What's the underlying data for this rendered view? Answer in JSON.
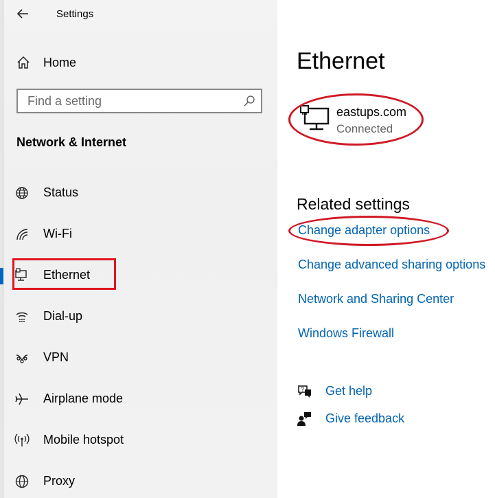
{
  "window": {
    "title": "Settings"
  },
  "sidebar": {
    "home_label": "Home",
    "search_placeholder": "Find a setting",
    "section_title": "Network & Internet",
    "items": [
      {
        "label": "Status",
        "icon": "globe-icon"
      },
      {
        "label": "Wi-Fi",
        "icon": "wifi-icon"
      },
      {
        "label": "Ethernet",
        "icon": "ethernet-icon",
        "selected": true
      },
      {
        "label": "Dial-up",
        "icon": "dialup-icon"
      },
      {
        "label": "VPN",
        "icon": "vpn-icon"
      },
      {
        "label": "Airplane mode",
        "icon": "airplane-icon"
      },
      {
        "label": "Mobile hotspot",
        "icon": "hotspot-icon"
      },
      {
        "label": "Proxy",
        "icon": "proxy-globe-icon"
      }
    ]
  },
  "main": {
    "title": "Ethernet",
    "connection": {
      "name": "eastups.com",
      "status": "Connected"
    },
    "related_heading": "Related settings",
    "related_links": [
      "Change adapter options",
      "Change advanced sharing options",
      "Network and Sharing Center",
      "Windows Firewall"
    ],
    "help": {
      "get_help": "Get help",
      "give_feedback": "Give feedback"
    }
  },
  "colors": {
    "accent": "#0067c0",
    "link": "#0063b1",
    "annotation_red": "#d01a26"
  }
}
